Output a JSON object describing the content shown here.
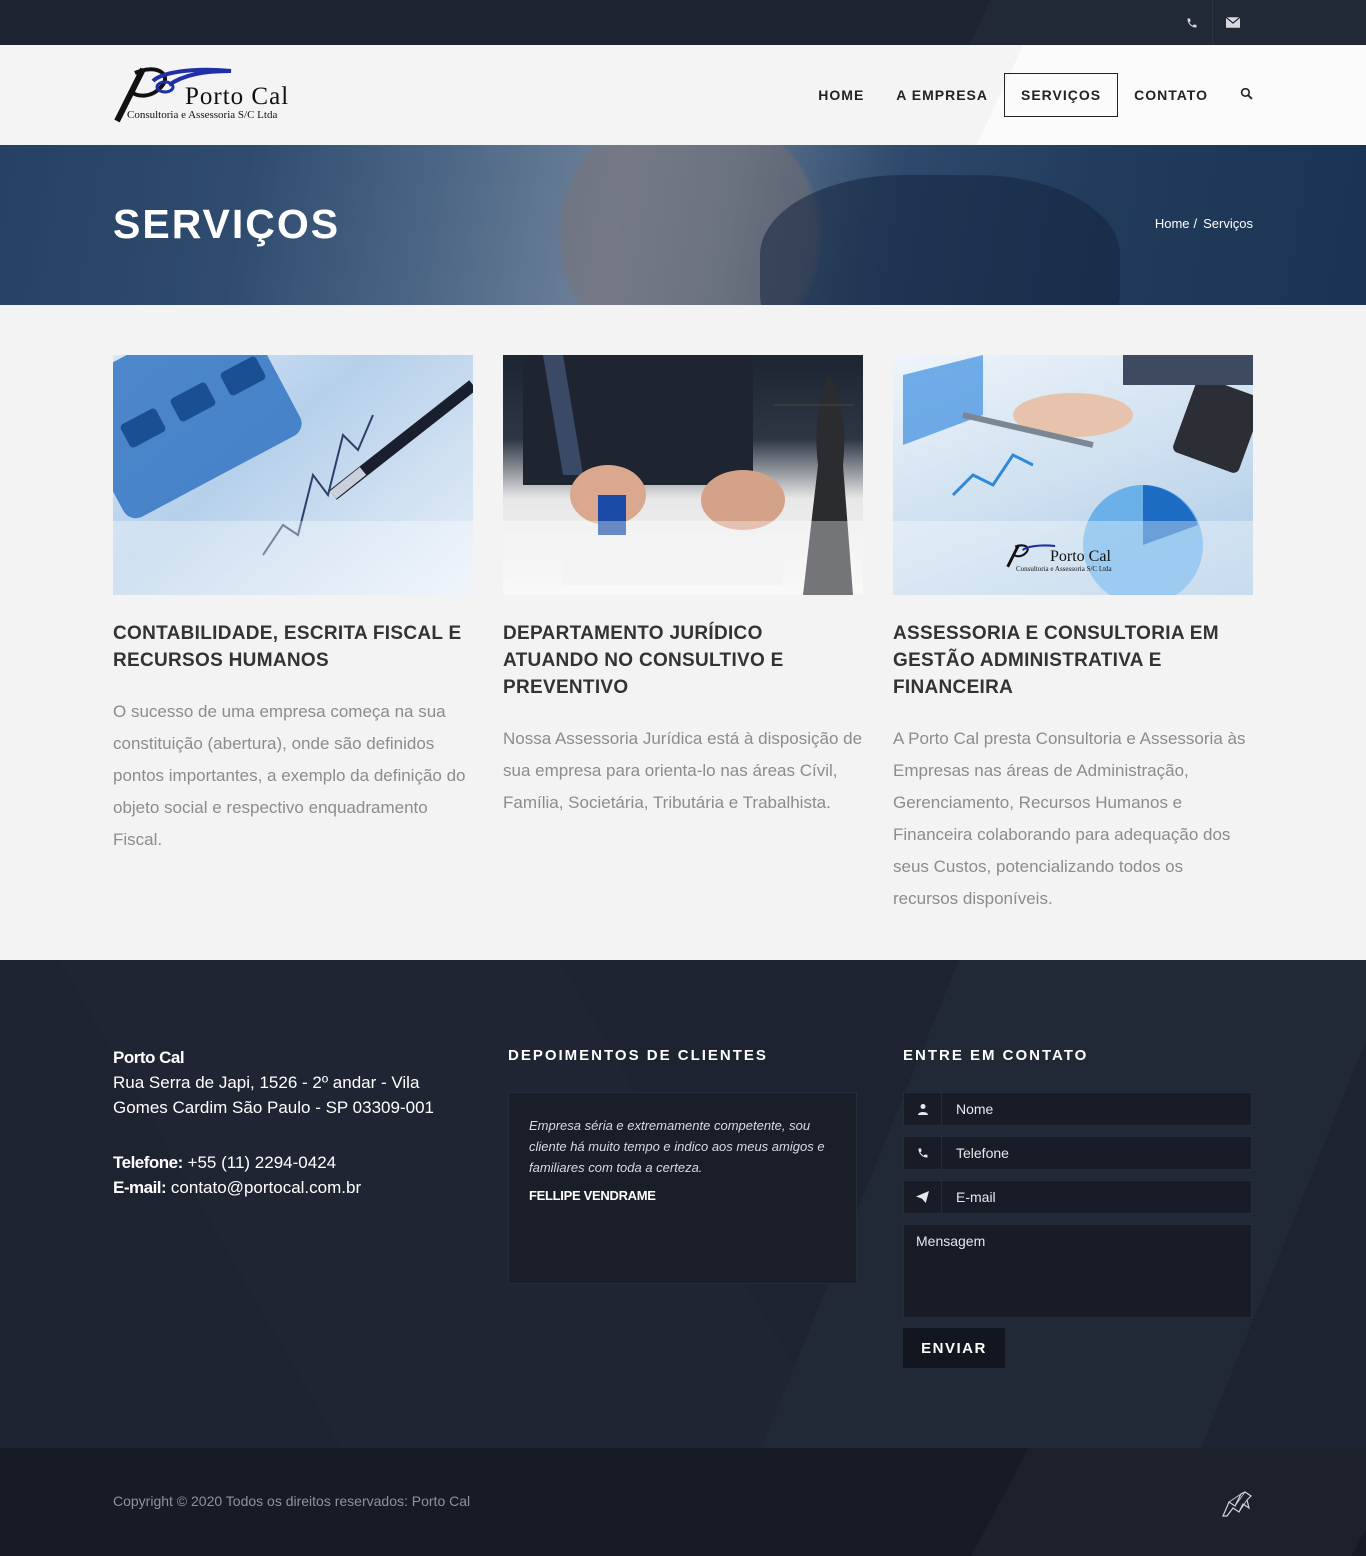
{
  "topbar": {
    "phone_icon": "phone-icon",
    "email_icon": "envelope-icon"
  },
  "header": {
    "logo": {
      "brand": "Porto Cal",
      "tagline": "Consultoria e Assessoria S/C Ltda"
    },
    "nav": [
      {
        "label": "HOME",
        "active": false
      },
      {
        "label": "A EMPRESA",
        "active": false
      },
      {
        "label": "SERVIÇOS",
        "active": true
      },
      {
        "label": "CONTATO",
        "active": false
      }
    ],
    "search_icon": "search-icon"
  },
  "banner": {
    "title": "SERVIÇOS",
    "breadcrumb": [
      "Home",
      "Serviços"
    ],
    "separator": "/"
  },
  "services": [
    {
      "title": "CONTABILIDADE, ESCRITA FISCAL E RECURSOS HUMANOS",
      "text": "O sucesso de uma empresa começa na sua constituição (abertura), onde são definidos pontos importantes, a exemplo da definição do objeto social e respectivo enquadramento Fiscal."
    },
    {
      "title": "DEPARTAMENTO JURÍDICO ATUANDO NO CONSULTIVO E PREVENTIVO",
      "text": "Nossa Assessoria Jurídica está à disposição de sua empresa para orienta-lo nas áreas Cívil, Família, Societária, Tributária e Trabalhista."
    },
    {
      "title": "ASSESSORIA E CONSULTORIA EM GESTÃO ADMINISTRATIVA E FINANCEIRA",
      "text": "A Porto Cal presta Consultoria e Assessoria às Empresas nas áreas de Administração, Gerenciamento, Recursos Humanos e Financeira colaborando para adequação dos seus Custos, potencializando todos os recursos disponíveis.",
      "image_logo": {
        "brand": "Porto Cal",
        "tagline": "Consultoria e Assessoria S/C Ltda"
      }
    }
  ],
  "footer": {
    "company": "Porto Cal",
    "address": "Rua Serra de Japi, 1526 - 2º andar - Vila Gomes Cardim São Paulo - SP 03309-001",
    "phone_label": "Telefone:",
    "phone": "+55 (11) 2294-0424",
    "email_label": "E-mail:",
    "email": "contato@portocal.com.br",
    "testimonials_title": "DEPOIMENTOS DE CLIENTES",
    "testimonial": {
      "quote": "Empresa séria e extremamente competente, sou cliente há muito tempo e indico aos meus amigos e familiares com toda a certeza.",
      "author": "FELLIPE VENDRAME"
    },
    "contact_title": "ENTRE EM CONTATO",
    "form": {
      "name_placeholder": "Nome",
      "phone_placeholder": "Telefone",
      "email_placeholder": "E-mail",
      "message_placeholder": "Mensagem",
      "submit": "ENVIAR"
    }
  },
  "copyright": "Copyright © 2020 Todos os direitos reservados: Porto Cal",
  "colors": {
    "dark": "#1d2330",
    "light_bg": "#f3f3f3",
    "text_muted": "#8c8c8c",
    "logo_blue": "#1f2fa8"
  }
}
